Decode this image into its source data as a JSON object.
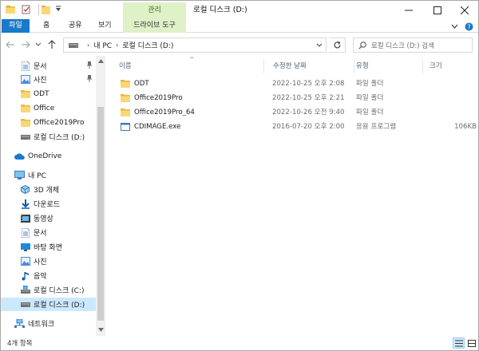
{
  "window": {
    "title": "로컬 디스크 (D:)",
    "manage_tab": "관리"
  },
  "ribbon": {
    "tabs": [
      {
        "label": "파일"
      },
      {
        "label": "홈"
      },
      {
        "label": "공유"
      },
      {
        "label": "보기"
      },
      {
        "label": "드라이브 도구"
      }
    ]
  },
  "address": {
    "segments": [
      "내 PC",
      "로컬 디스크 (D:)"
    ]
  },
  "search": {
    "placeholder": "로컬 디스크 (D:) 검색"
  },
  "nav": {
    "quick_access": [
      {
        "label": "문서",
        "icon": "documents-icon",
        "pinned": true
      },
      {
        "label": "사진",
        "icon": "pictures-icon",
        "pinned": true
      },
      {
        "label": "ODT",
        "icon": "folder-icon"
      },
      {
        "label": "Office",
        "icon": "folder-icon"
      },
      {
        "label": "Office2019Pro",
        "icon": "folder-icon"
      },
      {
        "label": "로컬 디스크 (D:)",
        "icon": "drive-icon"
      }
    ],
    "onedrive": {
      "label": "OneDrive",
      "icon": "cloud-icon"
    },
    "this_pc": {
      "label": "내 PC",
      "icon": "computer-icon"
    },
    "pc_items": [
      {
        "label": "3D 개체",
        "icon": "3d-objects-icon"
      },
      {
        "label": "다운로드",
        "icon": "downloads-icon"
      },
      {
        "label": "동영상",
        "icon": "videos-icon"
      },
      {
        "label": "문서",
        "icon": "documents-icon"
      },
      {
        "label": "바탕 화면",
        "icon": "desktop-icon"
      },
      {
        "label": "사진",
        "icon": "pictures-icon"
      },
      {
        "label": "음악",
        "icon": "music-icon"
      },
      {
        "label": "로컬 디스크 (C:)",
        "icon": "windows-drive-icon"
      },
      {
        "label": "로컬 디스크 (D:)",
        "icon": "drive-icon",
        "selected": true
      }
    ],
    "network": {
      "label": "네트워크",
      "icon": "network-icon"
    }
  },
  "columns": {
    "name": "이름",
    "date": "수정한 날짜",
    "type": "유형",
    "size": "크기"
  },
  "files": [
    {
      "name": "ODT",
      "date": "2022-10-25 오후 2:08",
      "type": "파일 폴더",
      "size": "",
      "icon": "folder-icon"
    },
    {
      "name": "Office2019Pro",
      "date": "2022-10-25 오후 2:21",
      "type": "파일 폴더",
      "size": "",
      "icon": "folder-icon"
    },
    {
      "name": "Office2019Pro_64",
      "date": "2022-10-26 오전 9:40",
      "type": "파일 폴더",
      "size": "",
      "icon": "folder-icon"
    },
    {
      "name": "CDIMAGE.exe",
      "date": "2016-07-20 오후 2:00",
      "type": "응용 프로그램",
      "size": "106KB",
      "icon": "exe-icon"
    }
  ],
  "status": {
    "item_count": "4개 항목"
  },
  "colors": {
    "accent": "#1979ca",
    "manage_tab": "#dff1c7",
    "folder": "#f8d775",
    "selection": "#cce8ff"
  }
}
